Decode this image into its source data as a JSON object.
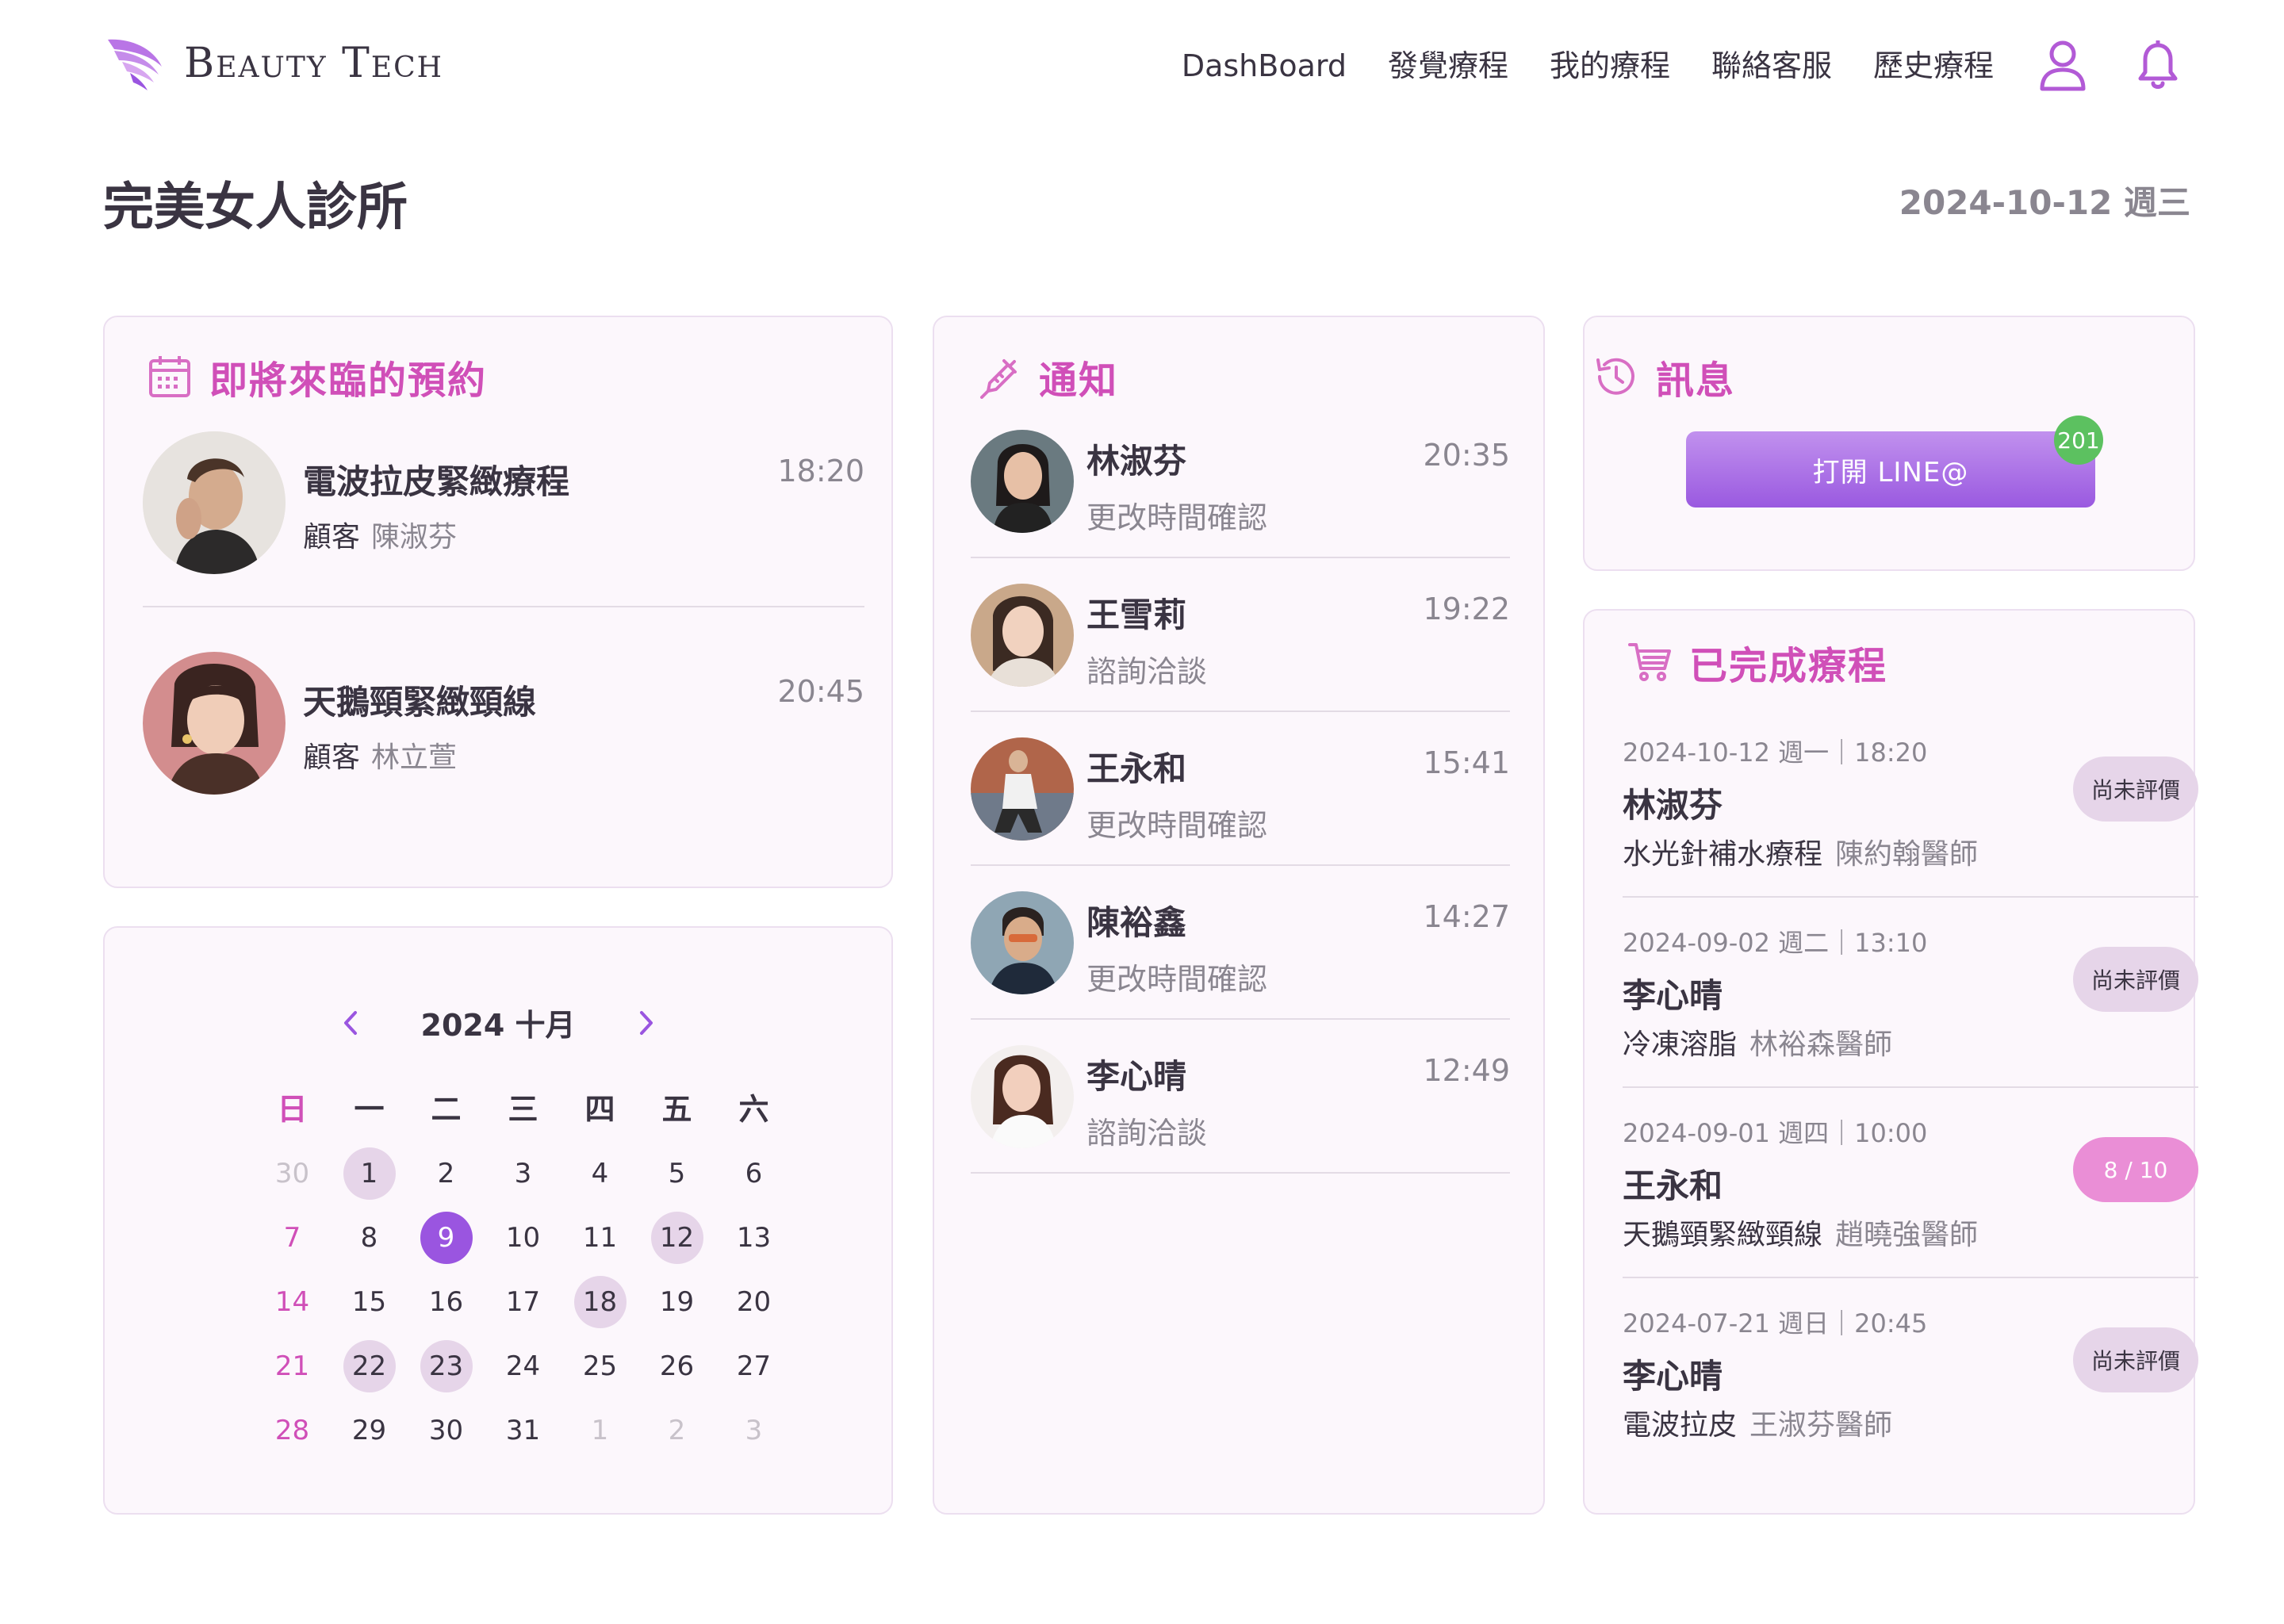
{
  "header": {
    "brand": "Beauty Tech",
    "nav": [
      "DashBoard",
      "發覺療程",
      "我的療程",
      "聯絡客服",
      "歷史療程"
    ],
    "icons": [
      "user-icon",
      "bell-icon"
    ]
  },
  "page": {
    "title": "完美女人診所",
    "date": "2024-10-12 週三"
  },
  "upcoming": {
    "title": "即將來臨的預約",
    "items": [
      {
        "treatment": "電波拉皮緊緻療程",
        "time": "18:20",
        "client_label": "顧客",
        "client": "陳淑芬"
      },
      {
        "treatment": "天鵝頸緊緻頸線",
        "time": "20:45",
        "client_label": "顧客",
        "client": "林立萱"
      }
    ]
  },
  "calendar": {
    "month_label": "2024 十月",
    "weekdays": [
      "日",
      "一",
      "二",
      "三",
      "四",
      "五",
      "六"
    ],
    "weeks": [
      [
        "30",
        "1",
        "2",
        "3",
        "4",
        "5",
        "6"
      ],
      [
        "7",
        "8",
        "9",
        "10",
        "11",
        "12",
        "13"
      ],
      [
        "14",
        "15",
        "16",
        "17",
        "18",
        "19",
        "20"
      ],
      [
        "21",
        "22",
        "23",
        "24",
        "25",
        "26",
        "27"
      ],
      [
        "28",
        "29",
        "30",
        "31",
        "1",
        "2",
        "3"
      ]
    ],
    "highlighted_days": [
      "1",
      "12",
      "18",
      "22",
      "23"
    ],
    "selected_day": "9"
  },
  "notifications": {
    "title": "通知",
    "items": [
      {
        "name": "林淑芬",
        "time": "20:35",
        "message": "更改時間確認"
      },
      {
        "name": "王雪莉",
        "time": "19:22",
        "message": "諮詢洽談"
      },
      {
        "name": "王永和",
        "time": "15:41",
        "message": "更改時間確認"
      },
      {
        "name": "陳裕鑫",
        "time": "14:27",
        "message": "更改時間確認"
      },
      {
        "name": "李心晴",
        "time": "12:49",
        "message": "諮詢洽談"
      }
    ]
  },
  "messages": {
    "title": "訊息",
    "button": "打開 LINE@",
    "badge": "201"
  },
  "completed": {
    "title": "已完成療程",
    "items": [
      {
        "date": "2024-10-12 週一｜18:20",
        "name": "林淑芬",
        "treatment": "水光針補水療程",
        "doctor": "陳約翰醫師",
        "status": "尚未評價"
      },
      {
        "date": "2024-09-02 週二｜13:10",
        "name": "李心晴",
        "treatment": "冷凍溶脂",
        "doctor": "林裕森醫師",
        "status": "尚未評價"
      },
      {
        "date": "2024-09-01 週四｜10:00",
        "name": "王永和",
        "treatment": "天鵝頸緊緻頸線",
        "doctor": "趙曉強醫師",
        "status": "8 / 10"
      },
      {
        "date": "2024-07-21 週日｜20:45",
        "name": "李心晴",
        "treatment": "電波拉皮",
        "doctor": "王淑芬醫師",
        "status": "尚未評價"
      }
    ]
  },
  "colors": {
    "accent": "#d04fb8",
    "purple": "#9a55e0",
    "booked": "#e6d5e9",
    "badge_green": "#5cc160",
    "rating_pink": "#ea8ed6"
  }
}
